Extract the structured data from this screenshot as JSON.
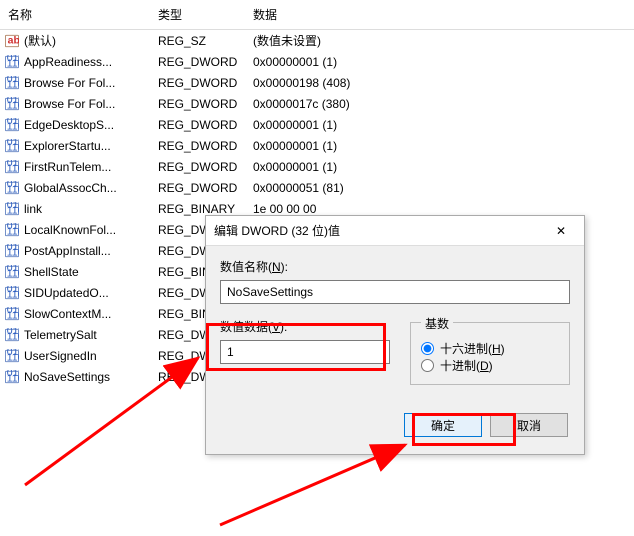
{
  "headers": {
    "name": "名称",
    "type": "类型",
    "data": "数据"
  },
  "rows": [
    {
      "icon": "str",
      "name": "(默认)",
      "type": "REG_SZ",
      "data": "(数值未设置)"
    },
    {
      "icon": "bin",
      "name": "AppReadiness...",
      "type": "REG_DWORD",
      "data": "0x00000001 (1)"
    },
    {
      "icon": "bin",
      "name": "Browse For Fol...",
      "type": "REG_DWORD",
      "data": "0x00000198 (408)"
    },
    {
      "icon": "bin",
      "name": "Browse For Fol...",
      "type": "REG_DWORD",
      "data": "0x0000017c (380)"
    },
    {
      "icon": "bin",
      "name": "EdgeDesktopS...",
      "type": "REG_DWORD",
      "data": "0x00000001 (1)"
    },
    {
      "icon": "bin",
      "name": "ExplorerStartu...",
      "type": "REG_DWORD",
      "data": "0x00000001 (1)"
    },
    {
      "icon": "bin",
      "name": "FirstRunTelem...",
      "type": "REG_DWORD",
      "data": "0x00000001 (1)"
    },
    {
      "icon": "bin",
      "name": "GlobalAssocCh...",
      "type": "REG_DWORD",
      "data": "0x00000051 (81)"
    },
    {
      "icon": "bin",
      "name": "link",
      "type": "REG_BINARY",
      "data": "1e 00 00 00"
    },
    {
      "icon": "bin",
      "name": "LocalKnownFol...",
      "type": "REG_DWORI",
      "data": ""
    },
    {
      "icon": "bin",
      "name": "PostAppInstall...",
      "type": "REG_DWORI",
      "data": ""
    },
    {
      "icon": "bin",
      "name": "ShellState",
      "type": "REG_BINARY",
      "data": ""
    },
    {
      "icon": "bin",
      "name": "SIDUpdatedO...",
      "type": "REG_DWORI",
      "data": ""
    },
    {
      "icon": "bin",
      "name": "SlowContextM...",
      "type": "REG_BINARY",
      "data": ""
    },
    {
      "icon": "bin",
      "name": "TelemetrySalt",
      "type": "REG_DWORI",
      "data": ""
    },
    {
      "icon": "bin",
      "name": "UserSignedIn",
      "type": "REG_DWORI",
      "data": ""
    },
    {
      "icon": "bin",
      "name": "NoSaveSettings",
      "type": "REG_DWORI",
      "data": ""
    }
  ],
  "dialog": {
    "title": "编辑 DWORD (32 位)值",
    "name_label_pre": "数值名称(",
    "name_label_key": "N",
    "name_label_post": "):",
    "name_value": "NoSaveSettings",
    "data_label_pre": "数值数据(",
    "data_label_key": "V",
    "data_label_post": "):",
    "data_value": "1",
    "radix_label": "基数",
    "radix_hex_pre": "十六进制(",
    "radix_hex_key": "H",
    "radix_hex_post": ")",
    "radix_dec_pre": "十进制(",
    "radix_dec_key": "D",
    "radix_dec_post": ")",
    "ok": "确定",
    "cancel": "取消"
  }
}
